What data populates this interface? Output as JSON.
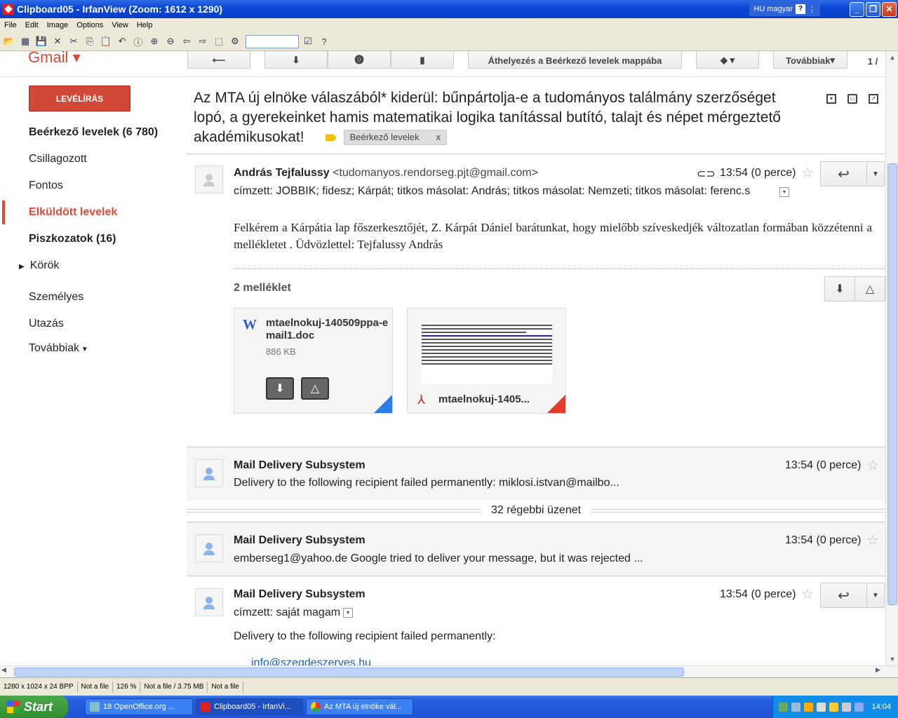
{
  "window": {
    "title": "Clipboard05 - IrfanView (Zoom: 1612 x 1290)",
    "lang": "HU magyar"
  },
  "menu": [
    "File",
    "Edit",
    "Image",
    "Options",
    "View",
    "Help"
  ],
  "gmail": {
    "logo": "Gmail",
    "toolbar": {
      "move_label": "Áthelyezés a Beérkező levelek mappába",
      "more_label": "Továbbiak",
      "count": "1 /"
    },
    "compose": "LEVÉLÍRÁS",
    "nav": {
      "inbox": "Beérkező levelek (6 780)",
      "starred": "Csillagozott",
      "important": "Fontos",
      "sent": "Elküldött levelek",
      "drafts": "Piszkozatok (16)",
      "circles": "Körök",
      "personal": "Személyes",
      "travel": "Utazás",
      "more": "Továbbiak"
    },
    "subject": "Az MTA új elnöke válaszából* kiderül: bűnpártolja-e a tudományos találmány szerzőséget lopó, a gyerekeinket hamis matematikai logika tanítással butító, talajt és népet mérgeztető akadémikusokat!",
    "label_chip": "Beérkező levelek",
    "label_chip_x": "x",
    "message1": {
      "sender": "András Tejfalussy",
      "email": "<tudomanyos.rendorseg.pjt@gmail.com>",
      "time": "13:54 (0 perce)",
      "to": "címzett: JOBBIK; fidesz; Kárpát; titkos másolat: András; titkos másolat: Nemzeti; titkos másolat: ferenc.s",
      "body": "Felkérem a Kárpátia lap főszerkesztőjét, Z. Kárpát Dániel barátunkat, hogy mielőbb szíveskedjék változatlan formában közzétenni a mellékletet . Üdvözlettel: Tejfalussy András",
      "attachments_label": "2 melléklet",
      "attachments": [
        {
          "name": "mtaelnokuj-140509ppa-email1.doc",
          "size": "886 KB"
        },
        {
          "name": "mtaelnokuj-1405..."
        }
      ]
    },
    "message2": {
      "sender": "Mail Delivery Subsystem",
      "time": "13:54 (0 perce)",
      "snippet": "Delivery to the following recipient failed permanently: miklosi.istvan@mailbo..."
    },
    "older": "32 régebbi üzenet",
    "message3": {
      "sender": "Mail Delivery Subsystem",
      "time": "13:54 (0 perce)",
      "snippet": "emberseg1@yahoo.de Google tried to deliver your message, but it was rejected ..."
    },
    "message4": {
      "sender": "Mail Delivery Subsystem",
      "time": "13:54 (0 perce)",
      "to": "címzett: saját magam",
      "body": "Delivery to the following recipient failed permanently:",
      "partial": "info@szegdeszerves.hu"
    }
  },
  "status": [
    "1280 x 1024 x 24 BPP",
    "Not a file",
    "126 %",
    "Not a file / 3.75 MB",
    "Not a file"
  ],
  "taskbar": {
    "start": "Start",
    "tasks": [
      "18 OpenOffice.org ...",
      "Clipboard05 - IrfanVi...",
      "Az MTA új elnöke vál..."
    ],
    "clock": "14:04"
  },
  "colors": {
    "accent_red": "#dd4b39",
    "compose_red": "#d14836",
    "xp_blue": "#245ee0"
  }
}
